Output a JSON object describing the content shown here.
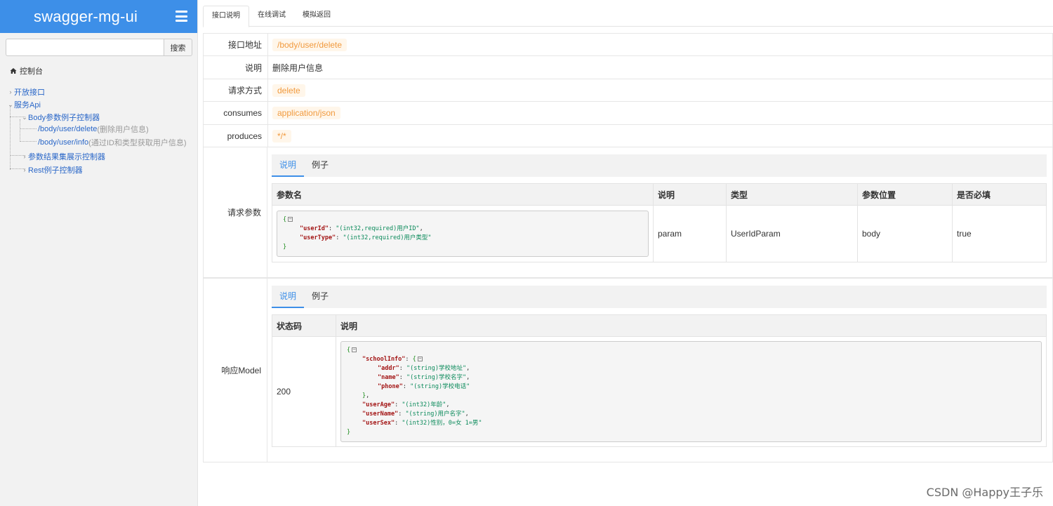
{
  "sidebar": {
    "brand": "swagger-mg-ui",
    "search_button": "搜索",
    "search_placeholder": "",
    "dashboard": "控制台",
    "tree": {
      "open_api": "开放接口",
      "service_api": "服务Api",
      "body_controller": "Body参数例子控制器",
      "delete_path": "/body/user/delete",
      "delete_desc": "(删除用户信息)",
      "info_path": "/body/user/info",
      "info_desc": "(通过ID和类型获取用户信息)",
      "result_controller": "参数结果集展示控制器",
      "rest_controller": "Rest例子控制器"
    }
  },
  "tabs": [
    "接口说明",
    "在线调试",
    "模拟返回"
  ],
  "doc": {
    "address_label": "接口地址",
    "address_value": "/body/user/delete",
    "desc_label": "说明",
    "desc_value": "删除用户信息",
    "method_label": "请求方式",
    "method_value": "delete",
    "consumes_label": "consumes",
    "consumes_value": "application/json",
    "produces_label": "produces",
    "produces_value": "*/*",
    "req_params_label": "请求参数",
    "resp_model_label": "响应Model"
  },
  "req": {
    "subtabs": [
      "说明",
      "例子"
    ],
    "headers": [
      "参数名",
      "说明",
      "类型",
      "参数位置",
      "是否必填"
    ],
    "row": {
      "json": {
        "userId_key": "\"userId\"",
        "userId_val": "\"(int32,required)用户ID\"",
        "userType_key": "\"userType\"",
        "userType_val": "\"(int32,required)用户类型\""
      },
      "desc": "param",
      "type": "UserIdParam",
      "position": "body",
      "required": "true"
    }
  },
  "resp": {
    "subtabs": [
      "说明",
      "例子"
    ],
    "headers": [
      "状态码",
      "说明"
    ],
    "code": "200",
    "json": {
      "schoolInfo_key": "\"schoolInfo\"",
      "addr_key": "\"addr\"",
      "addr_val": "\"(string)学校地址\"",
      "name_key": "\"name\"",
      "name_val": "\"(string)学校名字\"",
      "phone_key": "\"phone\"",
      "phone_val": "\"(string)学校电话\"",
      "userAge_key": "\"userAge\"",
      "userAge_val": "\"(int32)年龄\"",
      "userName_key": "\"userName\"",
      "userName_val": "\"(string)用户名字\"",
      "userSex_key": "\"userSex\"",
      "userSex_val": "\"(int32)性别，0=女 1=男\""
    }
  },
  "watermark": "CSDN @Happy王子乐",
  "colors": {
    "brand": "#3d8fe8",
    "link": "#2a67c8",
    "code": "#f19a3e"
  }
}
